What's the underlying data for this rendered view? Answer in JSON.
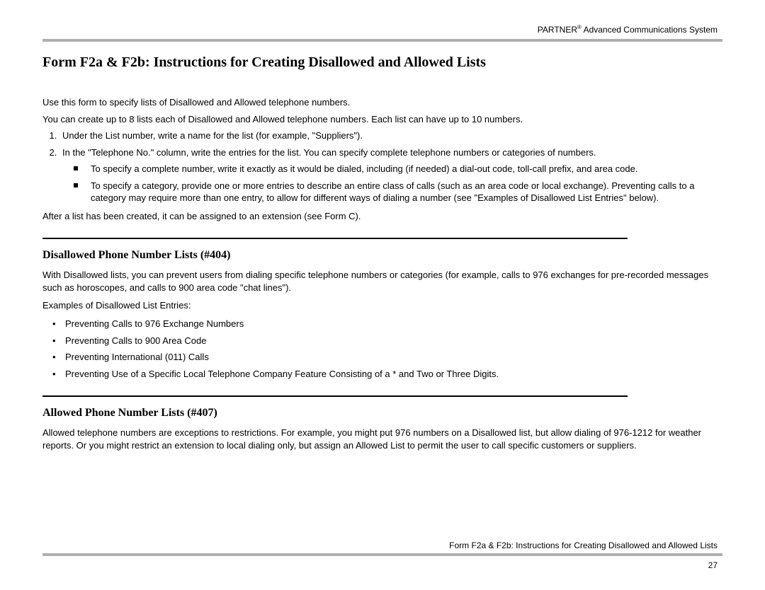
{
  "header": {
    "brand": "PARTNER",
    "brand_mark": "®",
    "suffix": " Advanced Communications System"
  },
  "title": "Form F2a & F2b: Instructions for Creating Disallowed and Allowed Lists",
  "intro": {
    "p1": "Use this form to specify lists of Disallowed and Allowed telephone numbers.",
    "p2": "You can create up to 8 lists each of Disallowed and Allowed telephone numbers. Each list can have up to 10 numbers."
  },
  "steps": {
    "s1": "Under the List number, write a name for the list (for example, \"Suppliers\").",
    "s2": "In the \"Telephone No.\" column, write the entries for the list. You can specify complete telephone numbers or categories of numbers.",
    "sub1": "To specify a complete number, write it exactly as it would be dialed, including (if needed) a dial-out code, toll-call prefix, and area code.",
    "sub2": "To specify a category, provide one or more entries to describe an entire class of calls (such as an area code or local exchange). Preventing calls to a category may require more than one entry, to allow for different ways of dialing a number (see \"Examples of Disallowed List Entries\" below)."
  },
  "after_note": "After a list has been created, it can be assigned to an extension (see Form C).",
  "section_disallowed": {
    "heading": "Disallowed Phone Number Lists (#404)",
    "p1": "With Disallowed lists, you can prevent users from dialing specific telephone numbers or categories (for example, calls to 976 exchanges for pre-recorded messages such as horoscopes, and calls to 900 area code \"chat lines\").",
    "examples_label": "Examples of Disallowed List Entries:",
    "ex1": "Preventing Calls to 976 Exchange Numbers",
    "ex2": "Preventing Calls to 900 Area Code",
    "ex3": "Preventing International (011) Calls",
    "ex4": "Preventing Use of a Specific Local Telephone Company Feature Consisting of a * and Two or Three Digits."
  },
  "section_allowed": {
    "heading": "Allowed Phone Number Lists (#407)",
    "p1": "Allowed telephone numbers are exceptions to restrictions. For example, you might put 976 numbers on a Disallowed list, but allow dialing of 976-1212 for weather reports. Or you might restrict an extension to local dialing only, but assign an Allowed List to permit the user to call specific customers or suppliers."
  },
  "footer": {
    "text": "Form F2a & F2b: Instructions for Creating Disallowed and Allowed Lists",
    "page_number": "27"
  }
}
